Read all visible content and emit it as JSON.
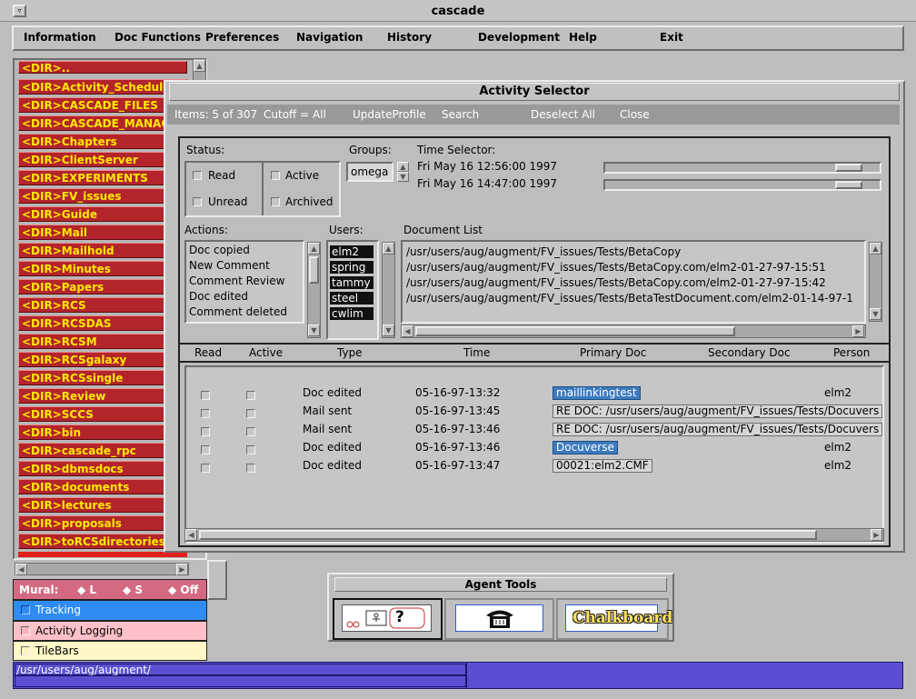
{
  "window": {
    "title": "cascade"
  },
  "menu": [
    "Information",
    "Doc Functions",
    "Preferences",
    "Navigation",
    "History",
    "Development",
    "Help",
    "Exit"
  ],
  "dirs": [
    "<DIR>..",
    "<DIR>Activity_Schedule",
    "<DIR>CASCADE_FILES",
    "<DIR>CASCADE_MANAGE",
    "<DIR>Chapters",
    "<DIR>ClientServer",
    "<DIR>EXPERIMENTS",
    "<DIR>FV_issues",
    "<DIR>Guide",
    "<DIR>Mail",
    "<DIR>Mailhold",
    "<DIR>Minutes",
    "<DIR>Papers",
    "<DIR>RCS",
    "<DIR>RCSDAS",
    "<DIR>RCSM",
    "<DIR>RCSgalaxy",
    "<DIR>RCSsingle",
    "<DIR>Review",
    "<DIR>SCCS",
    "<DIR>bin",
    "<DIR>cascade_rpc",
    "<DIR>dbmsdocs",
    "<DIR>documents",
    "<DIR>lectures",
    "<DIR>proposals",
    "<DIR>toRCSdirectories"
  ],
  "mural": {
    "label": "Mural:",
    "options": [
      "L",
      "S",
      "Off"
    ]
  },
  "toggles": {
    "tracking": "Tracking",
    "activity_logging": "Activity Logging",
    "tilebars": "TileBars"
  },
  "path": "/usr/users/aug/augment/",
  "agent_tools": {
    "title": "Agent Tools",
    "chalkboard": "Chalkboard",
    "help_glyph": "?"
  },
  "activity": {
    "title": "Activity Selector",
    "toolbar": {
      "items": "Items: 5 of 307",
      "cutoff": "Cutoff = All",
      "update": "UpdateProfile",
      "search": "Search",
      "deselect": "Deselect All",
      "close": "Close"
    },
    "status": {
      "label": "Status:",
      "read": "Read",
      "unread": "Unread",
      "active": "Active",
      "archived": "Archived"
    },
    "groups": {
      "label": "Groups:",
      "value": "omega"
    },
    "time": {
      "label": "Time Selector:",
      "start": "Fri May 16 12:56:00 1997",
      "end": "Fri May 16 14:47:00 1997",
      "start_level": 0.93,
      "end_level": 0.93
    },
    "actions": {
      "label": "Actions:",
      "items": [
        "Doc copied",
        "New Comment",
        "Comment Review",
        "Doc edited",
        "Comment deleted"
      ]
    },
    "users": {
      "label": "Users:",
      "items": [
        "elm2",
        "spring",
        "tammy",
        "steel",
        "cwlim"
      ]
    },
    "doclist": {
      "label": "Document List",
      "items": [
        "/usr/users/aug/augment/FV_issues/Tests/BetaCopy",
        "/usr/users/aug/augment/FV_issues/Tests/BetaCopy.com/elm2-01-27-97-15:51",
        "/usr/users/aug/augment/FV_issues/Tests/BetaCopy.com/elm2-01-27-97-15:42",
        "/usr/users/aug/augment/FV_issues/Tests/BetaTestDocument.com/elm2-01-14-97-1"
      ]
    },
    "columns": {
      "read": "Read",
      "active": "Active",
      "type": "Type",
      "time": "Time",
      "primary": "Primary Doc",
      "secondary": "Secondary Doc",
      "person": "Person"
    },
    "rows": [
      {
        "type": "Doc edited",
        "time": "05-16-97-13:32",
        "primary": "maillinkingtest",
        "person": "elm2"
      },
      {
        "type": "Mail sent",
        "time": "05-16-97-13:45",
        "primary": "RE DOC: /usr/users/aug/augment/FV_issues/Tests/Docuvers",
        "person": ""
      },
      {
        "type": "Mail sent",
        "time": "05-16-97-13:46",
        "primary": "RE DOC: /usr/users/aug/augment/FV_issues/Tests/Docuvers",
        "person": ""
      },
      {
        "type": "Doc edited",
        "time": "05-16-97-13:46",
        "primary": "Docuverse",
        "person": "elm2"
      },
      {
        "type": "Doc edited",
        "time": "05-16-97-13:47",
        "primary": "00021:elm2.CMF",
        "person": "elm2"
      }
    ]
  }
}
